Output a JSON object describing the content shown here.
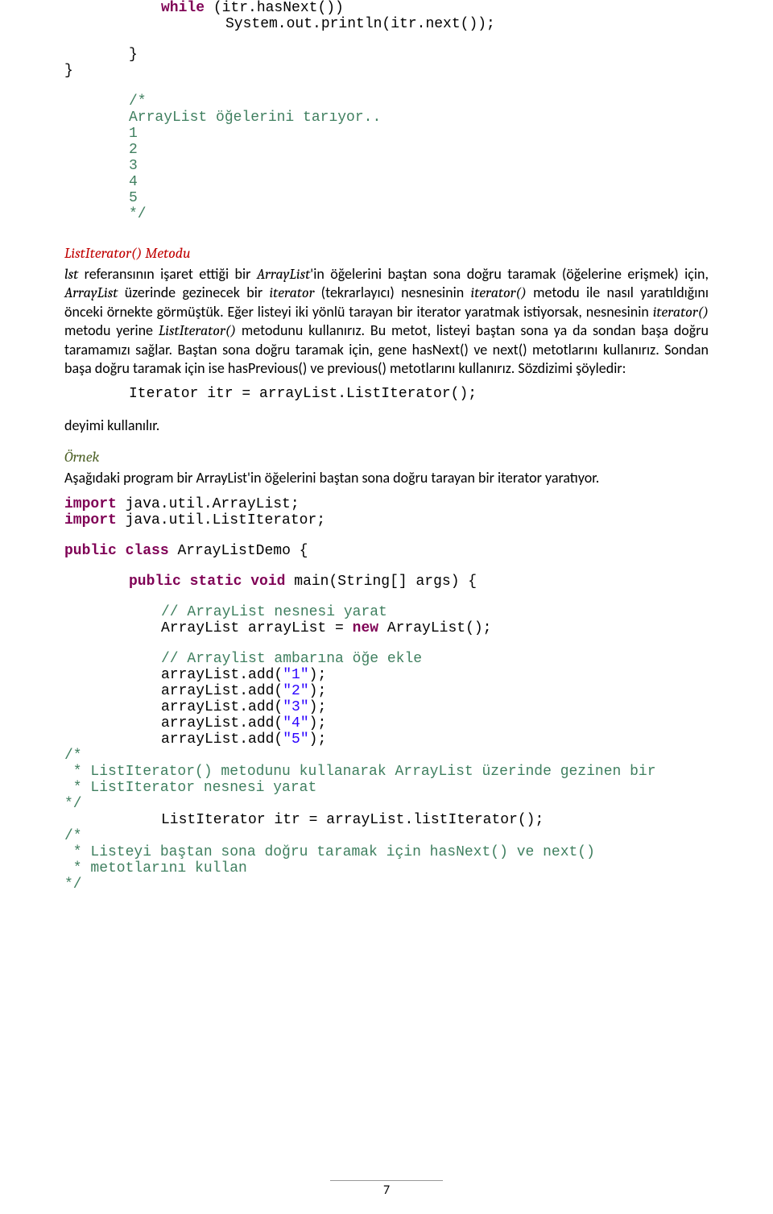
{
  "code0": {
    "while": "while",
    "cond": " (itr.hasNext())",
    "println": "System.out.println(itr.next());",
    "brace": "}",
    "c1": "/*",
    "c2": "ArrayList öğelerini tarıyor..",
    "c3": "1",
    "c4": "2",
    "c5": "3",
    "c6": "4",
    "c7": "5",
    "c8": "*/"
  },
  "heading1": "ListIterator() Metodu",
  "para1": {
    "a": " referansının işaret ettiği bir ",
    "b": "'in öğelerini baştan sona doğru taramak (öğelerine erişmek) için, ",
    "c": " üzerinde gezinecek bir ",
    "d": " (tekrarlayıcı) nesnesinin ",
    "e": " metodu ile nasıl yaratıldığını önceki örnekte görmüştük. Eğer listeyi iki yönlü tarayan bir iterator yaratmak istiyorsak, nesnesinin ",
    "f": " metodu yerine ",
    "g": " metodunu kullanırız. Bu metot, listeyi baştan sona ya da sondan başa doğru taramamızı sağlar. Baştan sona doğru taramak için, gene hasNext() ve next() metotlarını kullanırız. Sondan başa doğru taramak için ise hasPrevious() ve previous() metotlarını kullanırız. Sözdizimi şöyledir:",
    "lst": "lst",
    "ArrayList": "ArrayList",
    "iterator": "iterator",
    "iteratorFn": "iterator()",
    "ListIteratorFn": "ListIterator()"
  },
  "codeIter": "Iterator itr = arrayList.ListIterator();",
  "deyimi": "deyimi kullanılır.",
  "ornek": "Örnek",
  "para2": "Aşağıdaki program bir ArrayList'in öğelerini baştan sona doğru tarayan bir iterator yaratıyor.",
  "code1": {
    "import": "import",
    "imp1": " java.util.ArrayList;",
    "imp2": " java.util.ListIterator;",
    "public": "public",
    "class": "class",
    "clsname": " ArrayListDemo {",
    "static": "static",
    "void": "void",
    "mainDecl": " main(String[] args) {",
    "comment1": "// ArrayList nesnesi yarat",
    "new": "new",
    "newline": "ArrayList arrayList = ",
    "newtail": " ArrayList();",
    "comment2": "// Arraylist ambarına öğe ekle",
    "addPrefix": "arrayList.add(",
    "addSuffix": ");",
    "v1": "\"1\"",
    "v2": "\"2\"",
    "v3": "\"3\"",
    "v4": "\"4\"",
    "v5": "\"5\"",
    "block1_open": "/*",
    "block1_l1": " * ListIterator() metodunu kullanarak ArrayList üzerinde gezinen bir",
    "block1_l2": " * ListIterator nesnesi yarat",
    "block1_close": "*/",
    "listIterLine": "ListIterator itr = arrayList.listIterator();",
    "block2_open": "/*",
    "block2_l1": " * Listeyi baştan sona doğru taramak için hasNext() ve next()",
    "block2_l2": " * metotlarını kullan",
    "block2_close": "*/"
  },
  "pageNumber": "7"
}
